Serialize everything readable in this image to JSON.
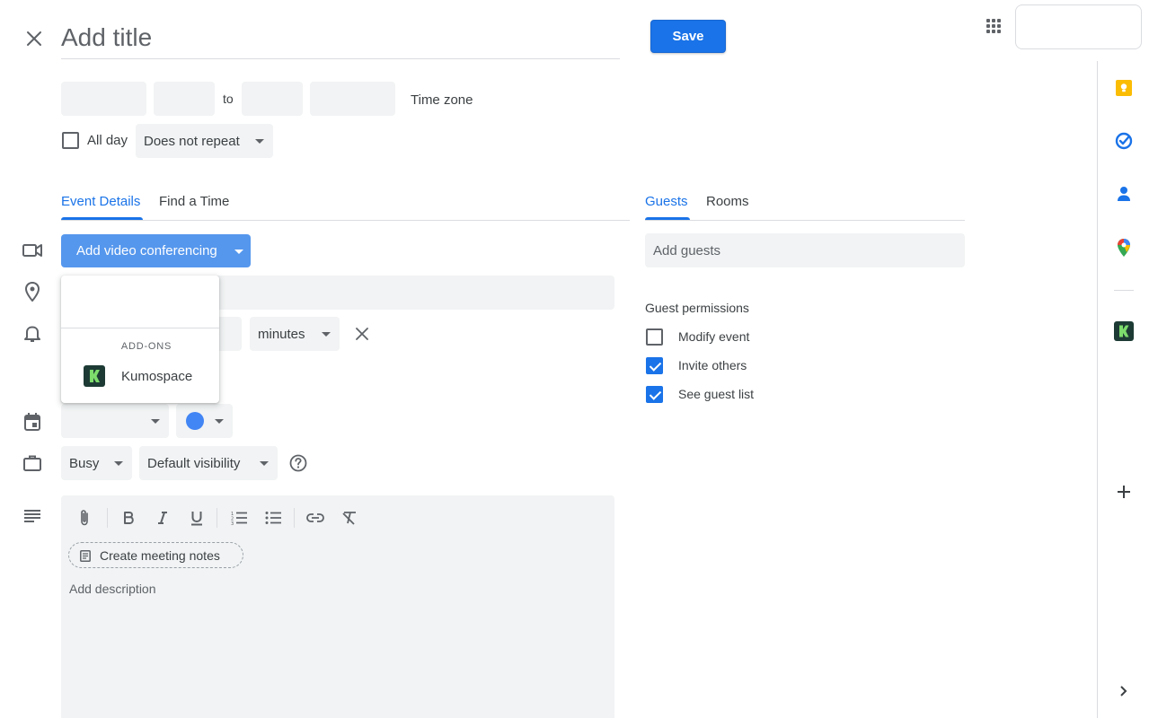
{
  "header": {
    "close_label": "Close",
    "title_placeholder": "Add title",
    "save_label": "Save"
  },
  "datetime": {
    "to_label": "to",
    "timezone_label": "Time zone",
    "allday_label": "All day",
    "repeat_value": "Does not repeat"
  },
  "tabs": {
    "left": [
      "Event Details",
      "Find a Time"
    ],
    "right": [
      "Guests",
      "Rooms"
    ]
  },
  "details": {
    "video_button_label": "Add video conferencing",
    "notification_unit": "minutes",
    "status_value": "Busy",
    "visibility_value": "Default visibility",
    "calendar_color": "#4285f4"
  },
  "conf_menu": {
    "section_header": "ADD-ONS",
    "items": [
      {
        "label": "Kumospace"
      }
    ]
  },
  "description": {
    "meeting_notes_label": "Create meeting notes",
    "placeholder": "Add description"
  },
  "guests": {
    "add_placeholder": "Add guests",
    "permissions_title": "Guest permissions",
    "permissions": [
      {
        "label": "Modify event",
        "checked": false
      },
      {
        "label": "Invite others",
        "checked": true
      },
      {
        "label": "See guest list",
        "checked": true
      }
    ]
  },
  "colors": {
    "accent": "#1a73e8",
    "field_bg": "#f1f3f4",
    "keep": "#fbbc04",
    "kumospace_logo": "#1d3b34",
    "kumospace_mark": "#7ddc6c"
  },
  "icons": [
    "close-icon",
    "apps-grid-icon",
    "video-icon",
    "location-icon",
    "bell-icon",
    "calendar-icon",
    "briefcase-icon",
    "description-icon",
    "help-icon",
    "attach-icon",
    "bold-icon",
    "italic-icon",
    "underline-icon",
    "numbered-list-icon",
    "bulleted-list-icon",
    "link-icon",
    "clear-format-icon",
    "notes-icon",
    "keep-icon",
    "tasks-icon",
    "contacts-icon",
    "maps-icon",
    "kumospace-icon",
    "add-icon",
    "chevron-right-icon"
  ]
}
